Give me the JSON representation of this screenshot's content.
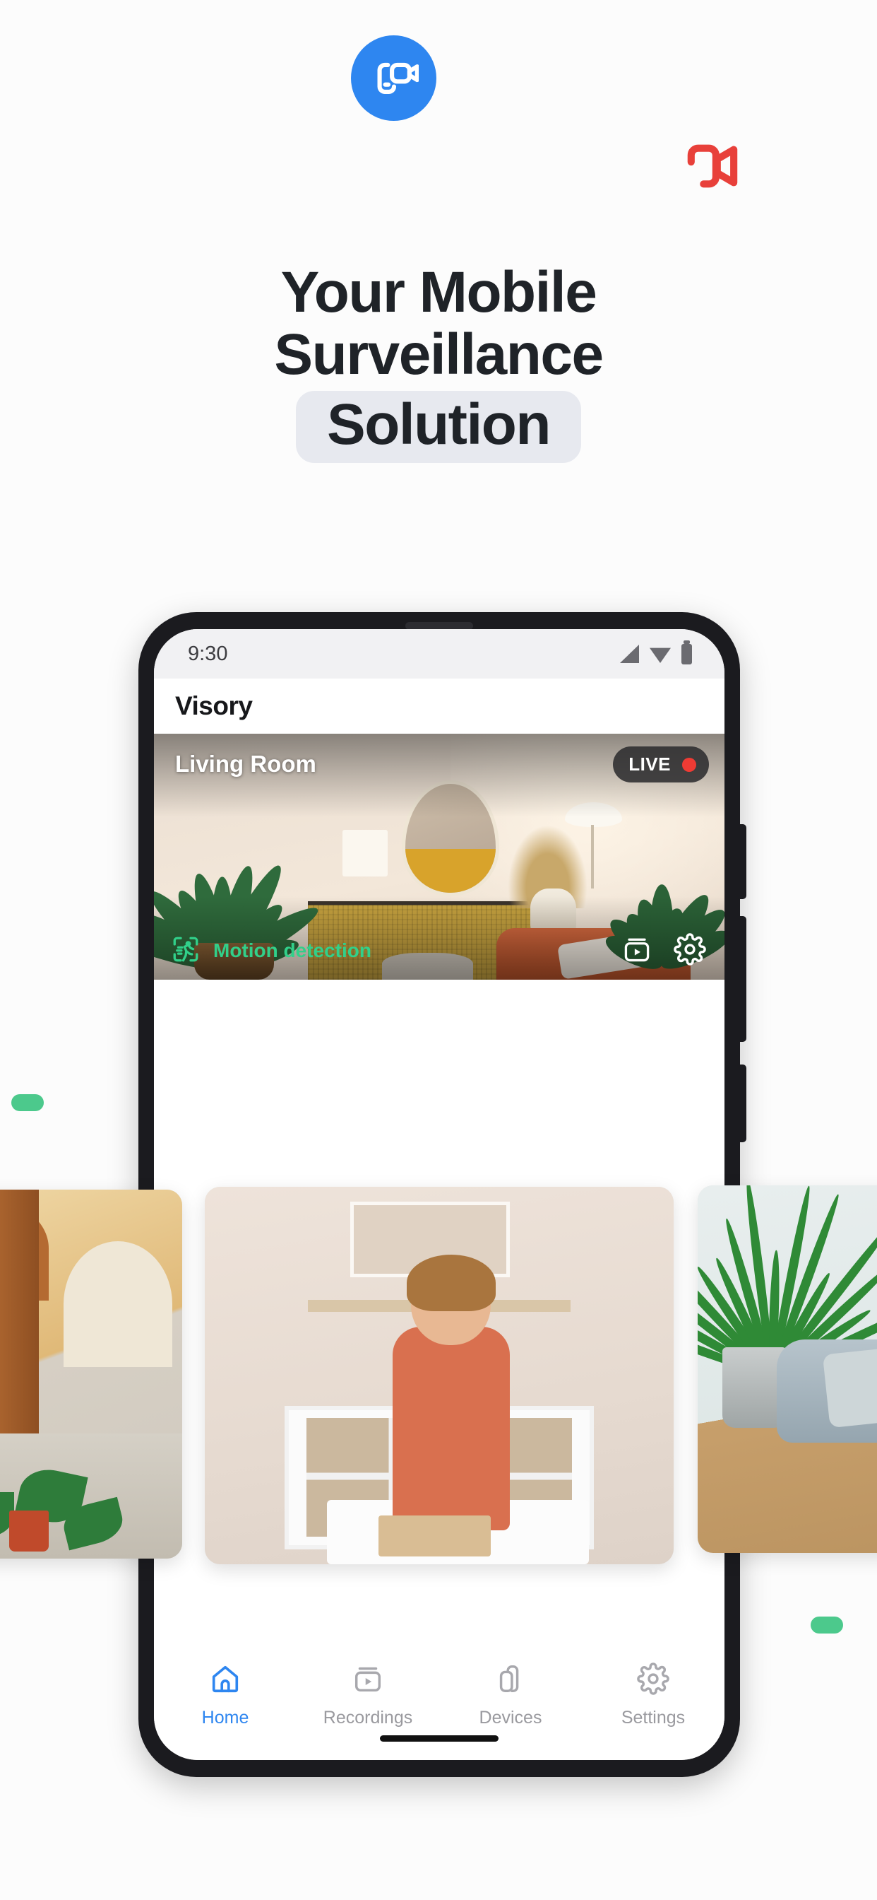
{
  "brand": {
    "logo_icon": "video-camera-icon",
    "logo_color": "#2e86f0",
    "accent_red": "#e8403a",
    "accent_green": "#31d08a"
  },
  "headline": {
    "line1": "Your Mobile",
    "line2": "Surveillance",
    "line3": "Solution",
    "highlight_color": "#e7e9ef"
  },
  "phone": {
    "statusbar": {
      "time": "9:30",
      "icons": [
        "signal-icon",
        "wifi-icon",
        "battery-icon"
      ]
    },
    "appbar": {
      "title": "Visory"
    },
    "live_feed": {
      "camera_name": "Living Room",
      "badge_label": "LIVE",
      "badge_dot_color": "#ef3b34",
      "motion_label": "Motion detection",
      "motion_icon": "motion-detection-icon",
      "action_icons": [
        "recordings-icon",
        "settings-gear-icon"
      ],
      "scene": "living room with plants, gold sideboard, round mirror and orange sofa"
    },
    "thumbnails": [
      {
        "name": "courtyard-camera",
        "scene": "sunlit mediterranean courtyard with arches and potted plants"
      },
      {
        "name": "playroom-camera",
        "scene": "child in orange shirt playing with wooden toys at a white table"
      },
      {
        "name": "pet-camera",
        "scene": "golden dog resting in a grey pet bed beside a palm plant"
      }
    ],
    "bottom_nav": [
      {
        "label": "Home",
        "icon": "home-icon",
        "active": true
      },
      {
        "label": "Recordings",
        "icon": "recordings-icon",
        "active": false
      },
      {
        "label": "Devices",
        "icon": "devices-icon",
        "active": false
      },
      {
        "label": "Settings",
        "icon": "settings-gear-icon",
        "active": false
      }
    ],
    "active_nav_color": "#2e86f0",
    "inactive_nav_color": "#9a9a9f"
  },
  "decorations": {
    "pill_color": "#4cc98c"
  }
}
